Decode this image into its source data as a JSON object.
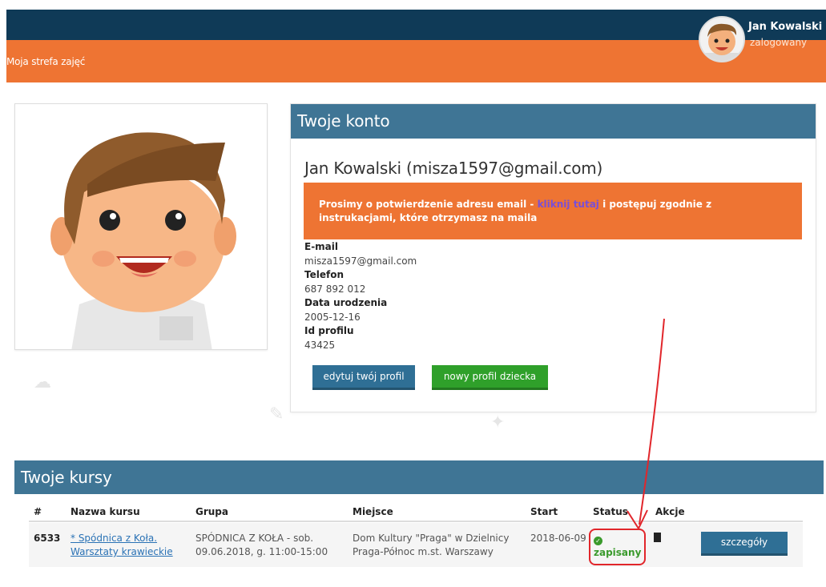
{
  "header": {
    "zone_link": "Moja strefa zajęć",
    "user_name": "Jan Kowalski",
    "user_status": "zalogowany"
  },
  "account": {
    "title": "Twoje konto",
    "name_line": "Jan Kowalski (misza1597@gmail.com)",
    "alert_prefix": "Prosimy o potwierdzenie adresu email - ",
    "alert_link": "kliknij tutaj",
    "alert_suffix": " i postępuj zgodnie z instrukacjami, które otrzymasz na maila",
    "fields": [
      {
        "label": "E-mail",
        "value": "misza1597@gmail.com"
      },
      {
        "label": "Telefon",
        "value": "687 892 012"
      },
      {
        "label": "Data urodzenia",
        "value": "2005-12-16"
      },
      {
        "label": "Id profilu",
        "value": "43425"
      }
    ],
    "edit_button": "edytuj twój profil",
    "child_button": "nowy profil dziecka"
  },
  "courses": {
    "title": "Twoje kursy",
    "columns": [
      "#",
      "Nazwa kursu",
      "Grupa",
      "Miejsce",
      "Start",
      "Status",
      "Akcje"
    ],
    "rows": [
      {
        "id": "6533",
        "name_line1": "* Spódnica z Koła.",
        "name_line2": "Warsztaty krawieckie",
        "group_line1": "SPÓDNICA Z KOŁA - sob.",
        "group_line2": "09.06.2018, g. 11:00-15:00",
        "place_line1": "Dom Kultury \"Praga\" w Dzielnicy",
        "place_line2": "Praga-Północ m.st. Warszawy",
        "start": "2018-06-09",
        "status": "zapisany",
        "details_button": "szczegóły"
      }
    ]
  },
  "colors": {
    "navy": "#0f3a57",
    "orange": "#ee7433",
    "panel_blue": "#3f7595",
    "green": "#2fa02a",
    "annotation_red": "#e1262b"
  }
}
